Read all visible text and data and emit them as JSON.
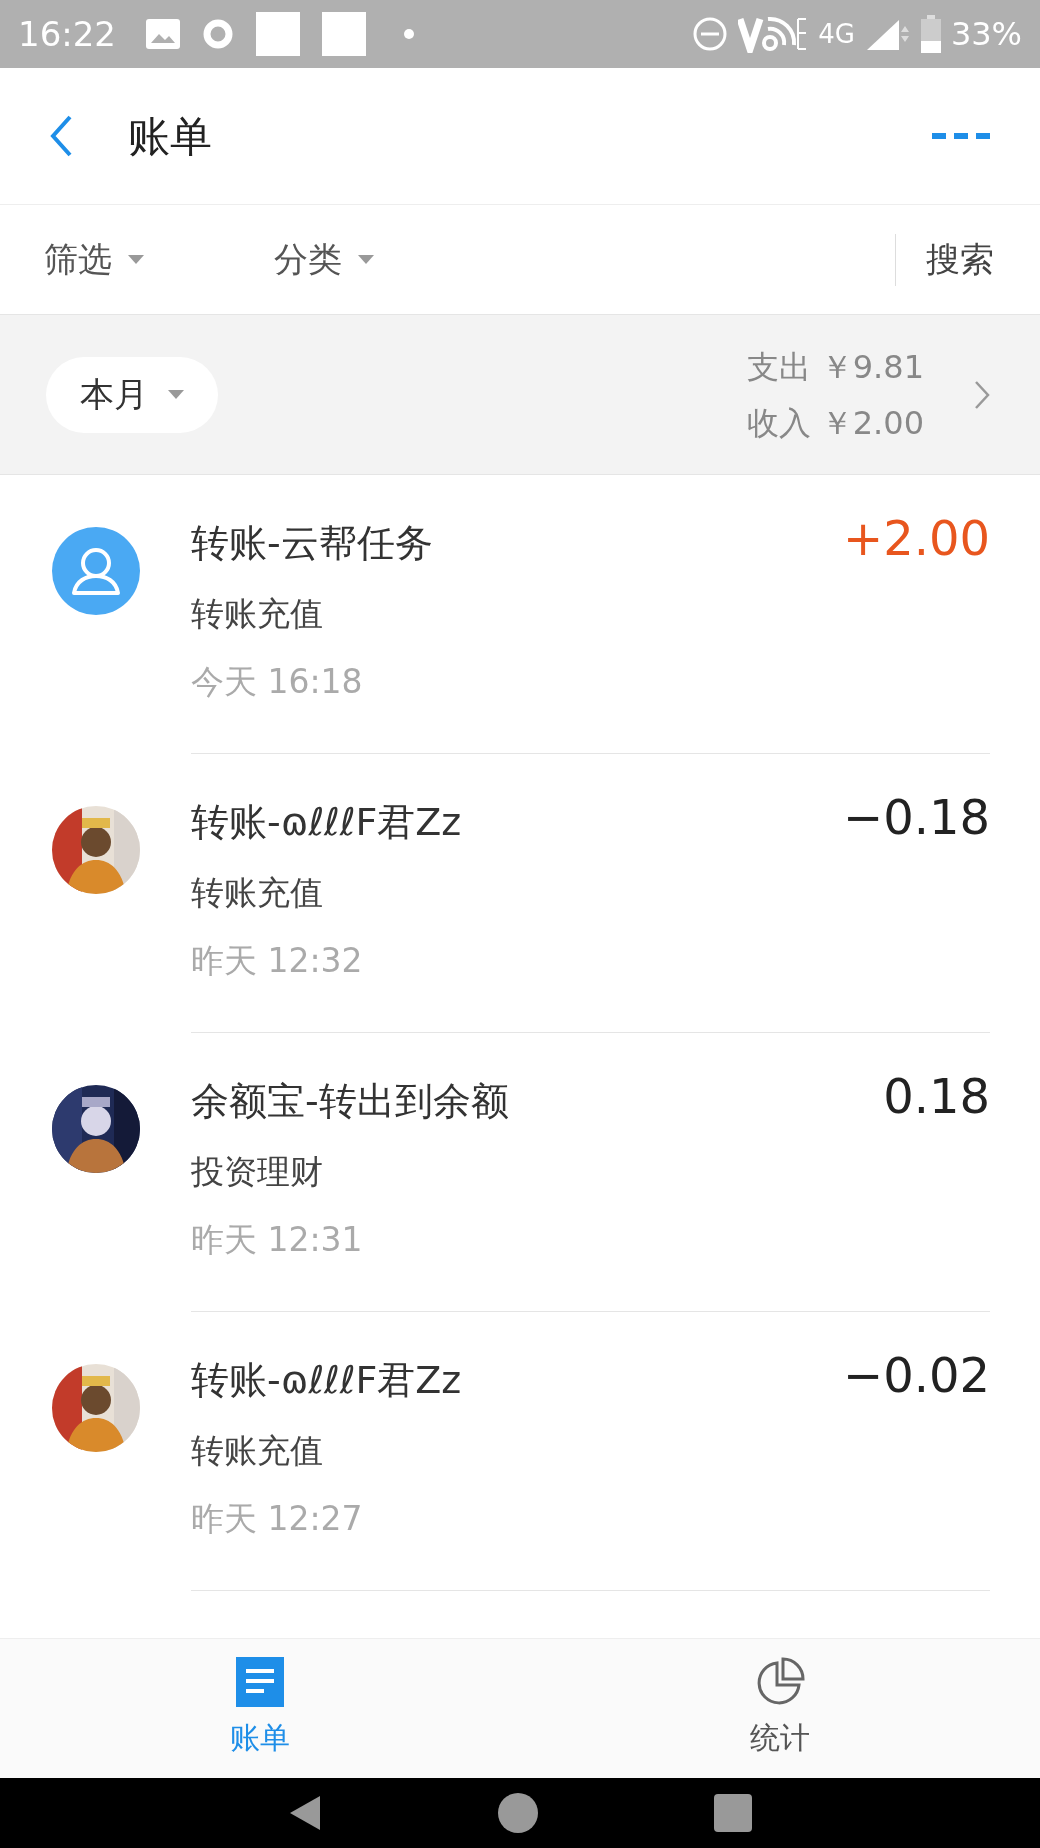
{
  "status_bar": {
    "time": "16:22",
    "network": "4G",
    "battery": "33%"
  },
  "header": {
    "title": "账单"
  },
  "filters": [
    {
      "label": "筛选"
    },
    {
      "label": "分类"
    }
  ],
  "search": "搜索",
  "summary": {
    "period": "本月",
    "expense_label": "支出",
    "expense": "￥9.81",
    "income_label": "收入",
    "income": "￥2.00"
  },
  "transactions": [
    {
      "kind": "default",
      "title": "转账-云帮任务",
      "category": "转账充值",
      "day": "今天",
      "time": "16:18",
      "amount": "+2.00",
      "income": true
    },
    {
      "kind": "picture",
      "title": "转账-ɷℓℓℓF君Zz",
      "category": "转账充值",
      "day": "昨天",
      "time": "12:32",
      "amount": "−0.18",
      "income": false
    },
    {
      "kind": "picture",
      "title": "余额宝-转出到余额",
      "category": "投资理财",
      "day": "昨天",
      "time": "12:31",
      "amount": "0.18",
      "income": false
    },
    {
      "kind": "picture",
      "title": "转账-ɷℓℓℓF君Zz",
      "category": "转账充值",
      "day": "昨天",
      "time": "12:27",
      "amount": "−0.02",
      "income": false
    }
  ],
  "tabs": [
    {
      "label": "账单",
      "selected": true
    },
    {
      "label": "统计",
      "selected": false
    }
  ]
}
